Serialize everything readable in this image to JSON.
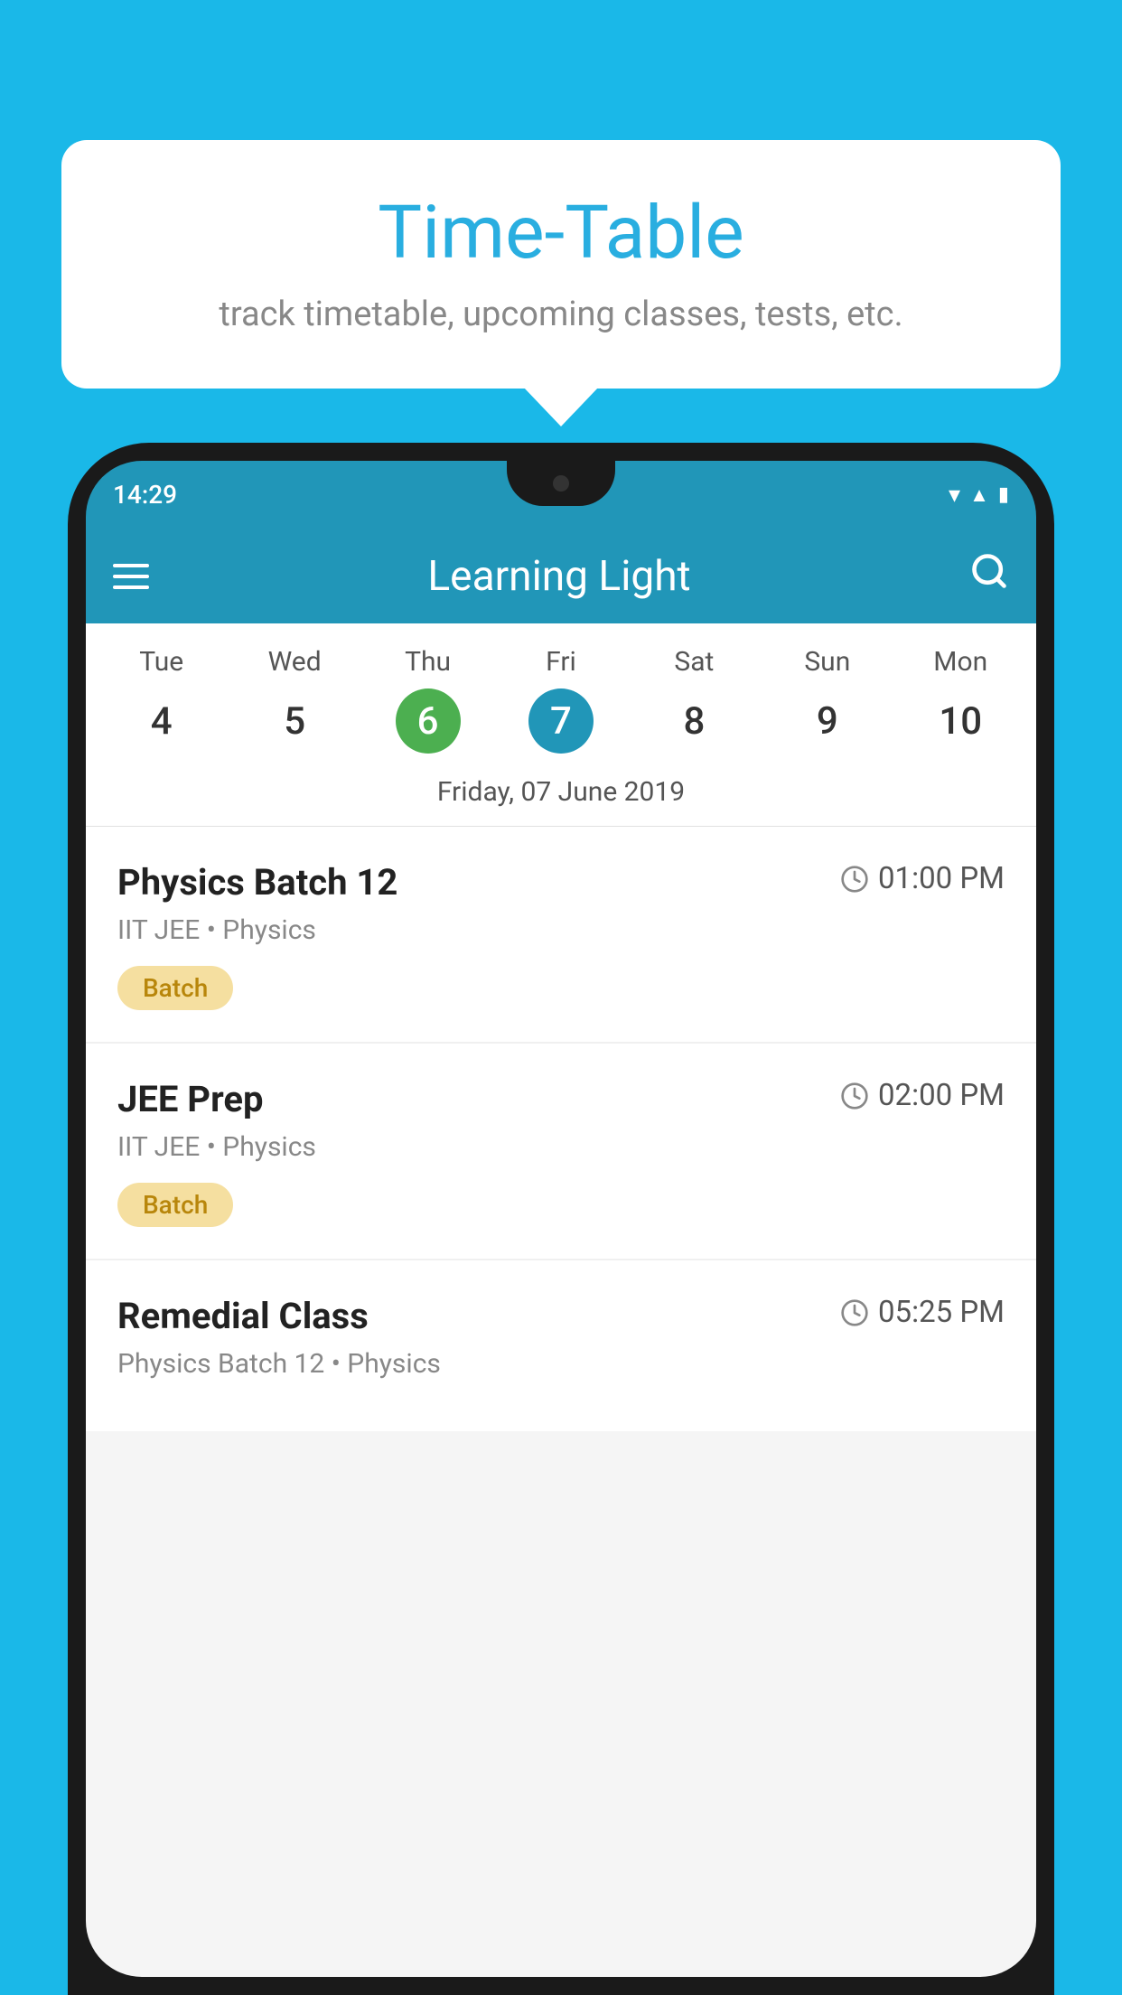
{
  "background_color": "#1ab8e8",
  "tooltip": {
    "title": "Time-Table",
    "subtitle": "track timetable, upcoming classes, tests, etc."
  },
  "phone": {
    "status_time": "14:29",
    "app_bar": {
      "title": "Learning Light"
    },
    "calendar": {
      "days": [
        {
          "name": "Tue",
          "num": "4",
          "state": "normal"
        },
        {
          "name": "Wed",
          "num": "5",
          "state": "normal"
        },
        {
          "name": "Thu",
          "num": "6",
          "state": "today"
        },
        {
          "name": "Fri",
          "num": "7",
          "state": "selected"
        },
        {
          "name": "Sat",
          "num": "8",
          "state": "normal"
        },
        {
          "name": "Sun",
          "num": "9",
          "state": "normal"
        },
        {
          "name": "Mon",
          "num": "10",
          "state": "normal"
        }
      ],
      "selected_date_label": "Friday, 07 June 2019"
    },
    "schedule": [
      {
        "title": "Physics Batch 12",
        "time": "01:00 PM",
        "subtitle": "IIT JEE • Physics",
        "badge": "Batch"
      },
      {
        "title": "JEE Prep",
        "time": "02:00 PM",
        "subtitle": "IIT JEE • Physics",
        "badge": "Batch"
      },
      {
        "title": "Remedial Class",
        "time": "05:25 PM",
        "subtitle": "Physics Batch 12 • Physics",
        "badge": null
      }
    ]
  }
}
